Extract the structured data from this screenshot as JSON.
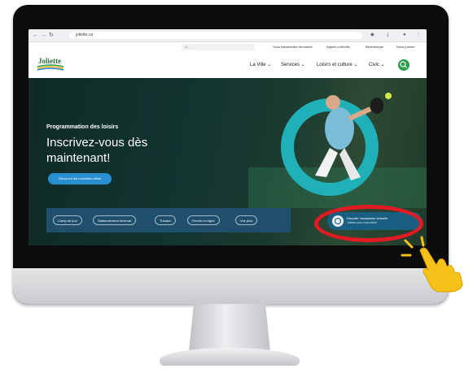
{
  "browser": {
    "url": "joliette.ca",
    "nav_back": "←",
    "nav_forward": "→",
    "nav_reload": "↻"
  },
  "utility": {
    "search_placeholder": "Q  ...",
    "links": [
      "Vous transmettez demande",
      "Appels collectifs",
      "Bibliothèque",
      "Nous joindre"
    ]
  },
  "header": {
    "logo_text": "Joliette",
    "nav": [
      "La Ville ⌄",
      "Services ⌄",
      "Loisirs et culture ⌄",
      "Civic ⌄"
    ]
  },
  "hero": {
    "subtitle": "Programmation des loisirs",
    "title": "Inscrivez-vous dès maintenant!",
    "cta": "Découvrir les nouvelles offres"
  },
  "quick_links": [
    "Camp de jour",
    "Stationnement hivernal",
    "Travaux",
    "Permis en ligne",
    "Voir plus"
  ],
  "chat": {
    "label": "Discuter l'assistante virtuelle",
    "sub": "Joliette pour vous aider!"
  },
  "colors": {
    "brand_green": "#2e9e4a",
    "hero_dark": "#123530",
    "accent_teal": "#1fb0b8",
    "chat_blue": "#1a5f82",
    "highlight_red": "#e01b24",
    "hand_yellow": "#f6c21a"
  },
  "icons": {
    "search": "search-icon",
    "chat": "chat-icon",
    "hand": "pointing-hand-icon"
  }
}
